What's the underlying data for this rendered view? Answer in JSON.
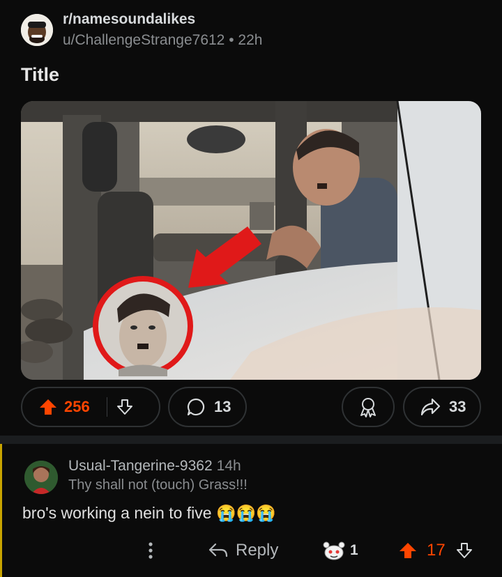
{
  "post": {
    "subreddit": "r/namesoundalikes",
    "author": "u/ChallengeStrange7612",
    "separator": "•",
    "age": "22h",
    "title": "Title"
  },
  "actions": {
    "upvotes": "256",
    "comments": "13",
    "shares": "33"
  },
  "comment": {
    "author": "Usual-Tangerine-9362",
    "age": "14h",
    "flair": "Thy shall not (touch) Grass!!!",
    "body": "bro's working a nein to five 😭😭😭",
    "reply_label": "Reply",
    "award_count": "1",
    "score": "17"
  },
  "colors": {
    "upvote": "#ff4500",
    "thread_line": "#c8a400",
    "background": "#0b0b0b"
  },
  "icons": [
    "upvote-icon",
    "downvote-icon",
    "comment-icon",
    "award-icon",
    "share-icon",
    "more-icon",
    "reply-icon",
    "snoo-award-icon"
  ]
}
